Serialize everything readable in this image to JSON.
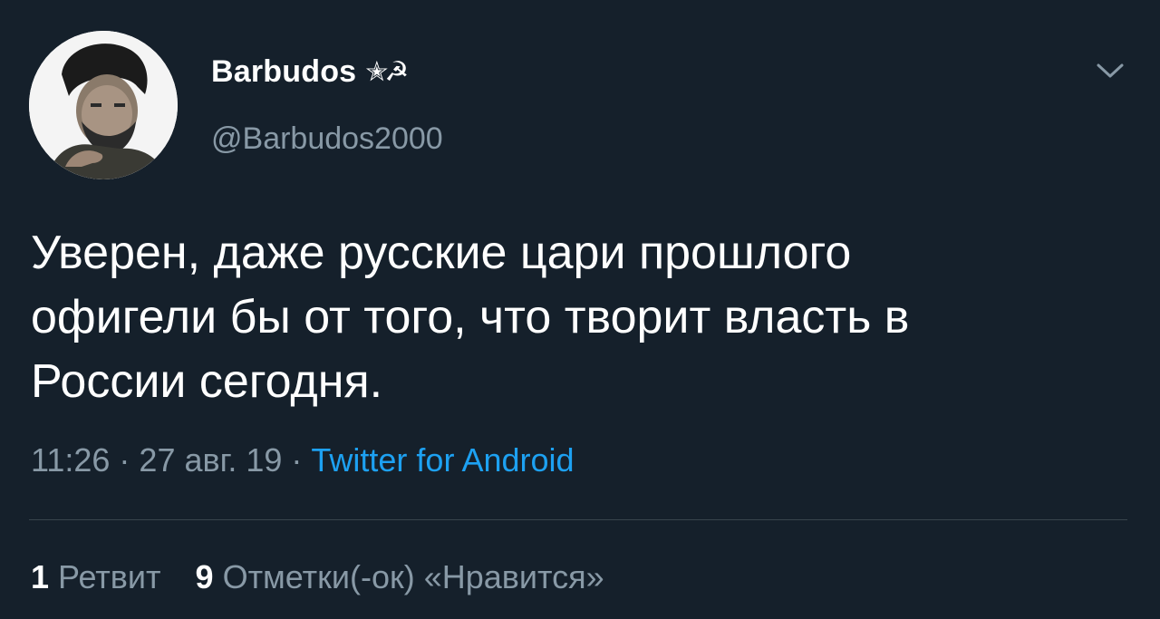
{
  "tweet": {
    "author": {
      "display_name": "Barbudos",
      "name_emoji": "✭☭",
      "handle": "@Barbudos2000"
    },
    "text_lines": [
      "Уверен, даже русские цари прошлого",
      "офигели бы от того, что творит власть в",
      "России сегодня."
    ],
    "time": "11:26",
    "date": "27 авг. 19",
    "separator": " · ",
    "source": "Twitter for Android",
    "stats": {
      "retweets_count": "1",
      "retweets_label": "Ретвит",
      "likes_count": "9",
      "likes_label": "Отметки(-ок) «Нравится»"
    },
    "colors": {
      "background": "#15202b",
      "secondary_text": "#8899a6",
      "link": "#1da1f2",
      "divider": "#38444d"
    }
  }
}
